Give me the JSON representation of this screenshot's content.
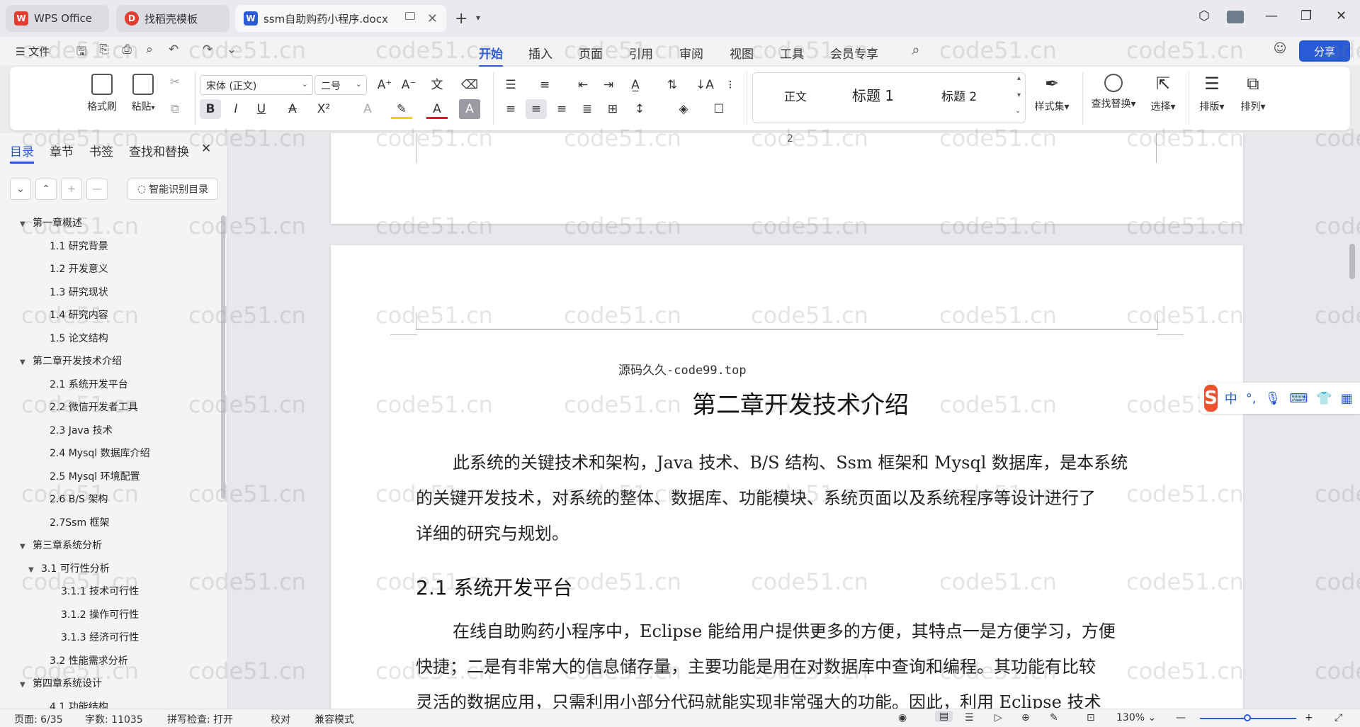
{
  "titlebar": {
    "tabs": [
      {
        "label": "WPS Office",
        "icon": "wps-logo"
      },
      {
        "label": "找稻壳模板",
        "icon": "docer-logo"
      },
      {
        "label": "ssm自助购药小程序.docx",
        "icon": "word-doc-logo"
      }
    ]
  },
  "menubar": {
    "file": "文件",
    "tabs": [
      "开始",
      "插入",
      "页面",
      "引用",
      "审阅",
      "视图",
      "工具",
      "会员专享"
    ],
    "active_tab": "开始",
    "share": "分享"
  },
  "ribbon": {
    "format_painter": "格式刷",
    "paste": "粘贴",
    "font_name": "宋体 (正文)",
    "font_size": "二号",
    "styles": {
      "normal": "正文",
      "heading1": "标题 1",
      "heading2": "标题 2"
    },
    "style_set": "样式集",
    "find_replace": "查找替换",
    "select": "选择",
    "layout": "排版",
    "arrange": "排列"
  },
  "leftpanel": {
    "tabs": [
      "目录",
      "章节",
      "书签",
      "查找和替换"
    ],
    "smart_toc": "智能识别目录",
    "toc": [
      {
        "label": "第一章概述",
        "level": 0,
        "expanded": true
      },
      {
        "label": "1.1 研究背景",
        "level": 1
      },
      {
        "label": "1.2 开发意义",
        "level": 1
      },
      {
        "label": "1.3  研究现状",
        "level": 1
      },
      {
        "label": "1.4  研究内容",
        "level": 1
      },
      {
        "label": "1.5 论文结构",
        "level": 1
      },
      {
        "label": "第二章开发技术介绍",
        "level": 0,
        "expanded": true
      },
      {
        "label": "2.1  系统开发平台",
        "level": 1
      },
      {
        "label": "2.2 微信开发者工具",
        "level": 1
      },
      {
        "label": "2.3 Java 技术",
        "level": 1
      },
      {
        "label": "2.4 Mysql 数据库介绍",
        "level": 1
      },
      {
        "label": "2.5 Mysql 环境配置",
        "level": 1
      },
      {
        "label": "2.6 B/S 架构",
        "level": 1
      },
      {
        "label": "2.7Ssm 框架",
        "level": 1
      },
      {
        "label": "第三章系统分析",
        "level": 0,
        "expanded": true
      },
      {
        "label": "3.1  可行性分析",
        "level": 1,
        "expanded": true
      },
      {
        "label": "3.1.1 技术可行性",
        "level": 2
      },
      {
        "label": "3.1.2 操作可行性",
        "level": 2
      },
      {
        "label": "3.1.3 经济可行性",
        "level": 2
      },
      {
        "label": "3.2  性能需求分析",
        "level": 1
      },
      {
        "label": "第四章系统设计",
        "level": 0,
        "expanded": true
      },
      {
        "label": "4.1 功能结构",
        "level": 1
      }
    ]
  },
  "document": {
    "page_number": "2",
    "header_text": "源码久久-code99.top",
    "chapter_title": "第二章开发技术介绍",
    "para1": [
      "此系统的关键技术和架构，Java 技术、B/S 结构、Ssm 框架和 Mysql 数据库，是本系统",
      "的关键开发技术，对系统的整体、数据库、功能模块、系统页面以及系统程序等设计进行了",
      "详细的研究与规划。"
    ],
    "section_title": "2.1  系统开发平台",
    "para2": [
      "在线自助购药小程序中，Eclipse 能给用户提供更多的方便，其特点一是方便学习，方便",
      "快捷；二是有非常大的信息储存量，主要功能是用在对数据库中查询和编程。其功能有比较",
      "灵活的数据应用，只需利用小部分代码就能实现非常强大的功能。因此，利用 Eclipse 技术"
    ]
  },
  "watermark": "code51.cn",
  "ime": {
    "lang": "中"
  },
  "statusbar": {
    "page": "页面: 6/35",
    "words": "字数: 11035",
    "spell": "拼写检查: 打开",
    "proof": "校对",
    "compat": "兼容模式",
    "zoom": "130%"
  },
  "colors": {
    "accent": "#2a5bd7",
    "wps_red": "#e23d2e",
    "ime_orange": "#f0522f"
  }
}
